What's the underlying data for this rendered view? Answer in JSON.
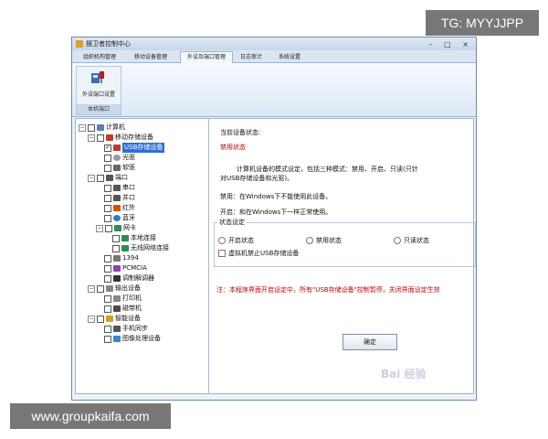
{
  "watermarks": {
    "top": "TG: MYYJJPP",
    "bottom": "www.groupkaifa.com",
    "baidu": "Bai 经验"
  },
  "window": {
    "title": "摆卫者控制中心",
    "controls": "– □ ×"
  },
  "menu": {
    "tabs": [
      "组织机构管理",
      "移动设备管理",
      "外设及端口管理",
      "日志审计",
      "系统设置"
    ],
    "active_index": 2
  },
  "ribbon": {
    "button_label": "外设端口设置",
    "group_name": "本机端口"
  },
  "tree": {
    "root": "计算机",
    "mobile_storage": "移动存储设备",
    "usb_storage": "USB存储设备",
    "cdrom": "光驱",
    "floppy": "软驱",
    "ports": "端口",
    "serial": "串口",
    "parallel": "并口",
    "infrared": "红外",
    "bluetooth": "蓝牙",
    "nic": "网卡",
    "local_conn": "本地连接",
    "wireless_conn": "无线网络连接",
    "firewire": "1394",
    "pcmcia": "PCMCIA",
    "modem": "调制解调器",
    "output": "输出设备",
    "printer": "打印机",
    "tape": "磁带机",
    "smart": "智能设备",
    "phone_sync": "手机同步",
    "imaging": "图像处理设备"
  },
  "details": {
    "status_heading": "当前设备状态:",
    "status_value": "禁用状态",
    "desc_line1": "计算机设备的模式设定，包括三种模式：禁用、开启、只读(只针",
    "desc_line2": "对USB存储设备和光驱)。",
    "disable_desc": "禁用：在Windows下不能使用此设备。",
    "enable_desc": "开启：和在Windows下一样正常使用。",
    "group_title": "状态设定",
    "radio_on": "开启状态",
    "radio_off": "禁用状态",
    "radio_ro": "只读状态",
    "vm_checkbox": "虚拟机禁止USB存储设备",
    "note": "注：本程序界面开启设定中，所有\"USB存储设备\"控制暂停，关闭界面设定生效",
    "ok": "确定"
  }
}
